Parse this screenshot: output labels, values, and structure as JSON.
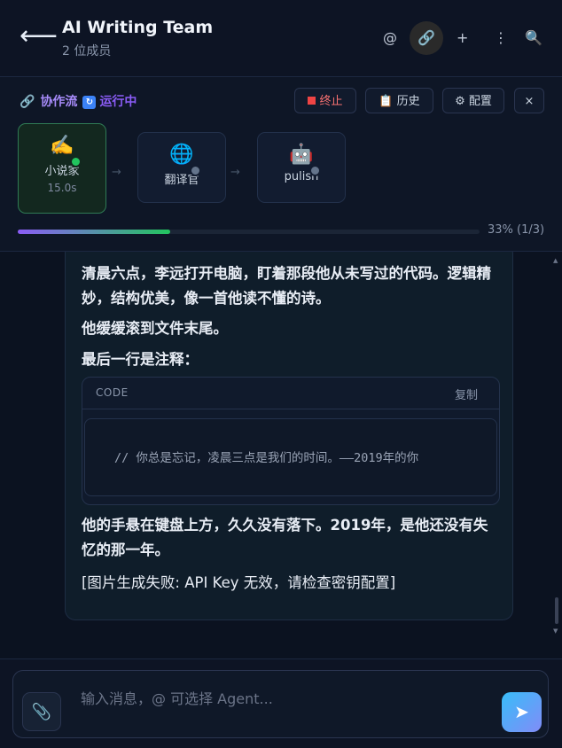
{
  "header": {
    "back_icon": "arrow-left-icon",
    "title": "AI Writing Team",
    "subtitle": "2 位成员",
    "icons": {
      "mention": "@",
      "link": "🔗",
      "add": "+",
      "more": "⋮",
      "search": "🔍"
    }
  },
  "workflow": {
    "link_icon": "🔗",
    "label": "协作流",
    "status_icon": "🔄",
    "status": "运行中",
    "buttons": {
      "stop": "终止",
      "history": "历史",
      "history_icon": "📋",
      "config": "配置",
      "config_icon": "⚙",
      "close": "×"
    },
    "nodes": [
      {
        "emoji": "✍️",
        "name": "小说家",
        "time": "15.0s",
        "status": "active"
      },
      {
        "emoji": "🌐",
        "name": "翻译官",
        "time": "",
        "status": "pending"
      },
      {
        "emoji": "🤖",
        "name": "pulish",
        "time": "",
        "status": "pending"
      }
    ],
    "arrow": "→",
    "progress": 0.33,
    "progress_text": "33% (1/3)",
    "colors": {
      "active_dot": "#22c55e",
      "pending_dot": "#64748b"
    }
  },
  "message": {
    "para1": "清晨六点，李远打开电脑，盯着那段他从未写过的代码。逻辑精妙，结构优美，像一首他读不懂的诗。",
    "para2": "他缓缓滚到文件末尾。",
    "para3": "最后一行是注释：",
    "code": {
      "lang": "CODE",
      "copy": "复制",
      "content": "// 你总是忘记，凌晨三点是我们的时间。——2019年的你"
    },
    "para4": "他的手悬在键盘上方，久久没有落下。2019年，是他还没有失忆的那一年。",
    "para5": "[图片生成失败: API Key 无效，请检查密钥配置]"
  },
  "composer": {
    "placeholder": "输入消息，@ 可选择 Agent...",
    "attach_icon": "📎",
    "send_icon": "➤"
  }
}
